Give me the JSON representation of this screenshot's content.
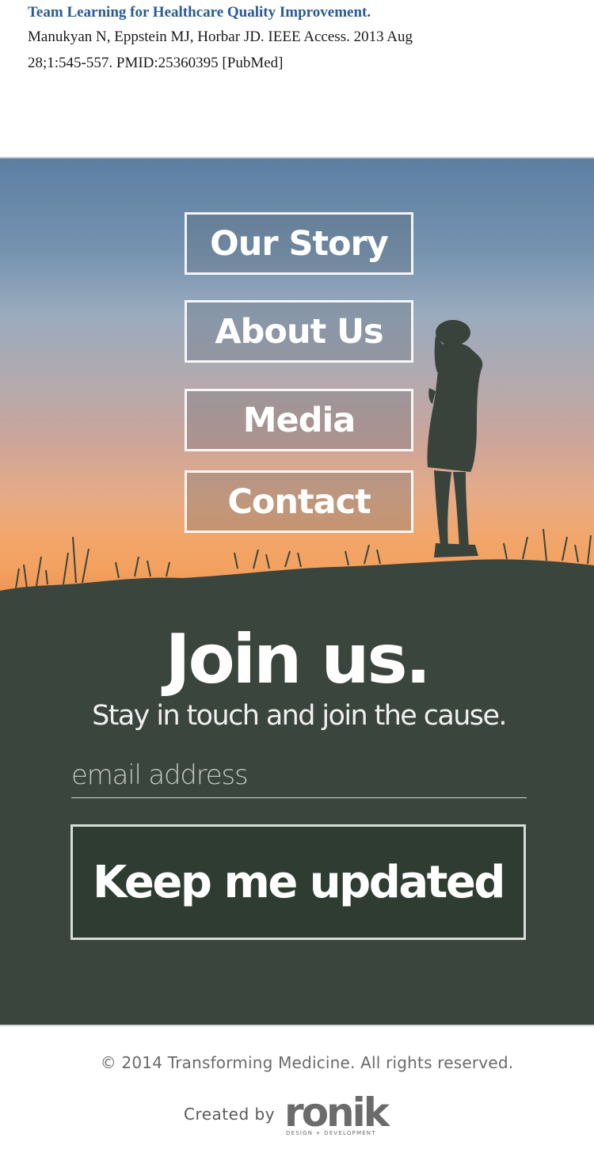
{
  "citation": {
    "title": "Team Learning for Healthcare Quality Improvement.",
    "line1": "Manukyan N, Eppstein MJ, Horbar JD. IEEE Access. 2013 Aug",
    "line2": "28;1:545-557. PMID:25360395 [PubMed]"
  },
  "nav": {
    "items": [
      {
        "label": "Our Story"
      },
      {
        "label": "About Us"
      },
      {
        "label": "Media"
      },
      {
        "label": "Contact"
      }
    ]
  },
  "signup": {
    "title": "Join us.",
    "subtitle": "Stay in touch and join the cause.",
    "email_placeholder": "email address",
    "email_value": "",
    "button_label": "Keep me updated"
  },
  "footer": {
    "copyright": "© 2014 Transforming Medicine. All rights reserved.",
    "created_by": "Created by",
    "logo_word": "ronik",
    "logo_tagline": "DESIGN + DEVELOPMENT"
  },
  "colors": {
    "link": "#2a5a95",
    "hero_dark": "#36433a",
    "sky_top": "#5b7ea2",
    "sunset": "#f3a15f",
    "button_border": "#ffffff"
  }
}
